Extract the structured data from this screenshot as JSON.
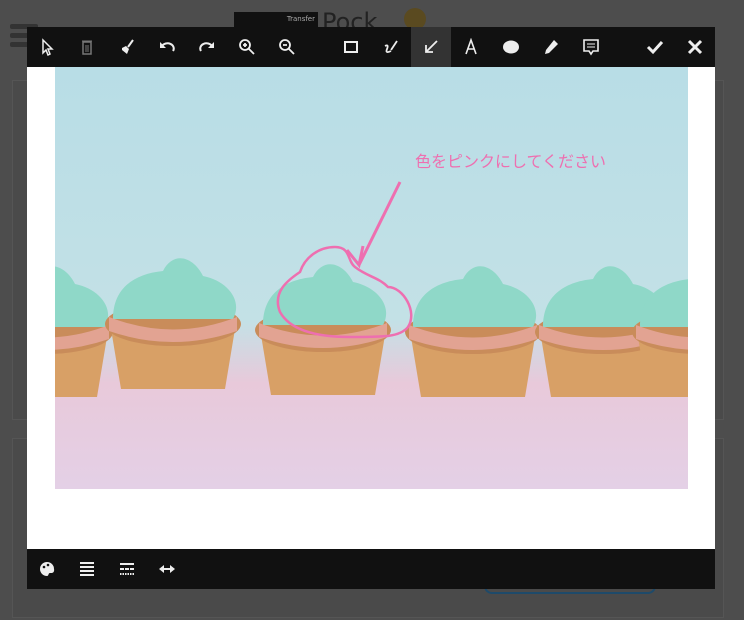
{
  "background": {
    "logo_tag": "Transfer",
    "logo_text": "Pock"
  },
  "editor": {
    "toolbar": [
      {
        "id": "select",
        "icon": "cursor-icon"
      },
      {
        "id": "delete",
        "icon": "trash-icon"
      },
      {
        "id": "clear",
        "icon": "broom-icon"
      },
      {
        "id": "undo",
        "icon": "undo-icon"
      },
      {
        "id": "redo",
        "icon": "redo-icon"
      },
      {
        "id": "zoom-in",
        "icon": "zoom-in-icon"
      },
      {
        "id": "zoom-out",
        "icon": "zoom-out-icon"
      },
      {
        "id": "rectangle",
        "icon": "rectangle-icon"
      },
      {
        "id": "freehand",
        "icon": "freehand-icon"
      },
      {
        "id": "arrow",
        "icon": "arrow-icon",
        "active": true
      },
      {
        "id": "text",
        "icon": "text-icon"
      },
      {
        "id": "ellipse",
        "icon": "ellipse-icon"
      },
      {
        "id": "highlighter",
        "icon": "pen-icon"
      },
      {
        "id": "comment",
        "icon": "comment-icon"
      },
      {
        "id": "confirm",
        "icon": "check-icon"
      },
      {
        "id": "close",
        "icon": "close-icon"
      }
    ],
    "annotation_text": "色をピンクにしてください",
    "annotation_color": "#ee6fb0",
    "bottom_toolbar": [
      {
        "id": "color",
        "icon": "palette-icon"
      },
      {
        "id": "line-width",
        "icon": "line-width-icon"
      },
      {
        "id": "line-style",
        "icon": "line-style-icon"
      },
      {
        "id": "arrow-heads",
        "icon": "double-arrow-icon"
      }
    ]
  }
}
